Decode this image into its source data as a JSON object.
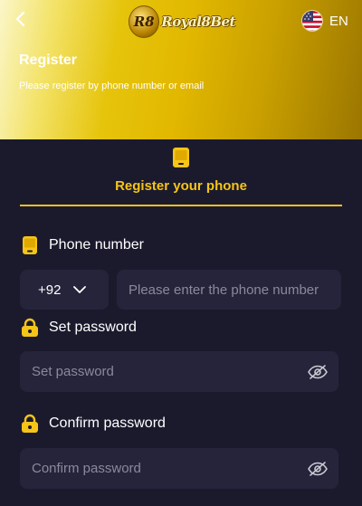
{
  "header": {
    "back_icon": "chevron-left-icon",
    "logo_mark": "R8",
    "logo_text": "Royal8Bet",
    "language": "EN",
    "title": "Register",
    "subtitle": "Please register by phone number or email"
  },
  "tab": {
    "label": "Register your phone",
    "icon": "phone-icon"
  },
  "phone": {
    "label": "Phone number",
    "country_code": "+92",
    "placeholder": "Please enter the phone number"
  },
  "password": {
    "label": "Set password",
    "placeholder": "Set password"
  },
  "confirm": {
    "label": "Confirm password",
    "placeholder": "Confirm password"
  },
  "colors": {
    "accent": "#f5c518",
    "background": "#1b1a2d",
    "input_background": "#25243a"
  }
}
